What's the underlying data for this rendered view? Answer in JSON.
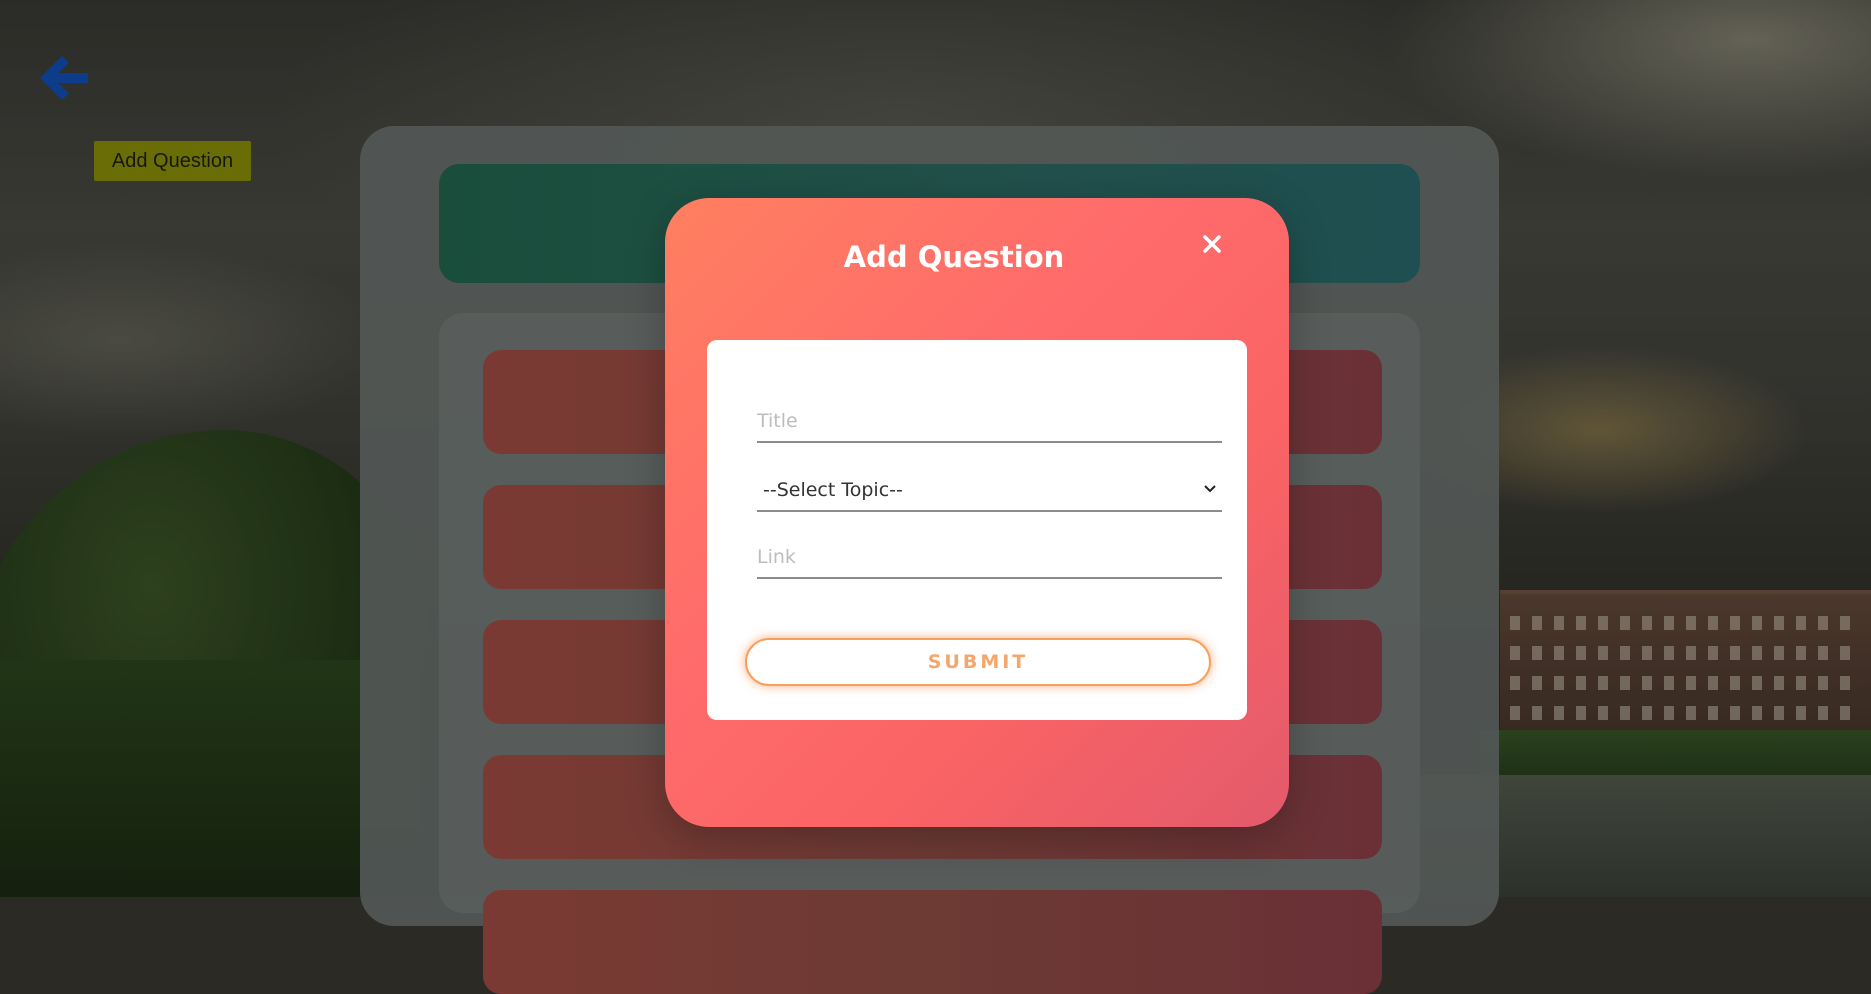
{
  "page": {
    "add_question_button_label": "Add Question"
  },
  "modal": {
    "title": "Add Question",
    "close_glyph": "×",
    "title_field": {
      "value": "",
      "placeholder": "Title"
    },
    "topic_select": {
      "selected": "--Select Topic--"
    },
    "link_field": {
      "value": "",
      "placeholder": "Link"
    },
    "submit_label": "SUBMIT"
  },
  "icons": {
    "back": "arrow-left-icon",
    "close": "close-icon",
    "dropdown": "chevron-down-icon"
  },
  "colors": {
    "back_arrow": "#0c3c8a",
    "add_question_bg": "#6a6d06",
    "modal_gradient_start": "#ff7f60",
    "modal_gradient_end": "#e35a6c",
    "submit_border": "#f7a05a",
    "submit_text": "#f5a66a"
  }
}
